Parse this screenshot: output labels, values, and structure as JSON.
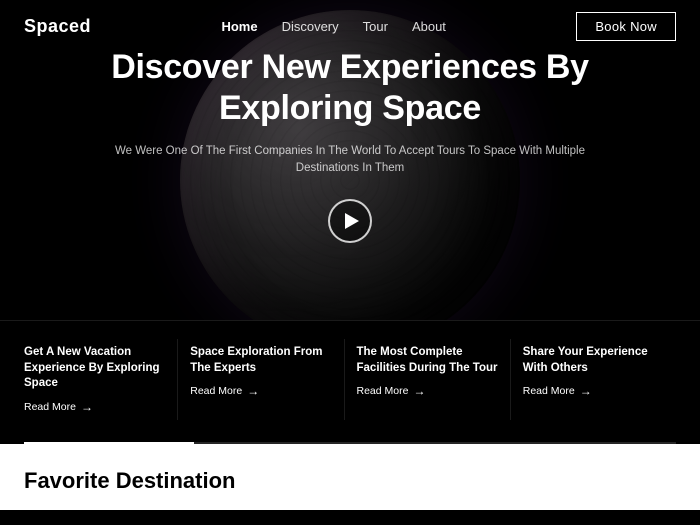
{
  "navbar": {
    "logo": "Spaced",
    "links": [
      {
        "label": "Home",
        "active": true
      },
      {
        "label": "Discovery",
        "active": false
      },
      {
        "label": "Tour",
        "active": false
      },
      {
        "label": "About",
        "active": false
      }
    ],
    "book_btn": "Book Now"
  },
  "hero": {
    "title": "Discover New Experiences By Exploring Space",
    "subtitle": "We Were One Of The First Companies In The World To Accept Tours To Space With Multiple Destinations In Them",
    "play_btn_label": "Play video"
  },
  "features": [
    {
      "title": "Get A New Vacation Experience By Exploring Space",
      "read_more": "Read More"
    },
    {
      "title": "Space Exploration From The Experts",
      "read_more": "Read More"
    },
    {
      "title": "The Most Complete Facilities During The Tour",
      "read_more": "Read More"
    },
    {
      "title": "Share Your Experience With Others",
      "read_more": "Read More"
    }
  ],
  "progress": {
    "fill_percent": 26
  },
  "favorite_section": {
    "title": "Favorite Destination"
  }
}
